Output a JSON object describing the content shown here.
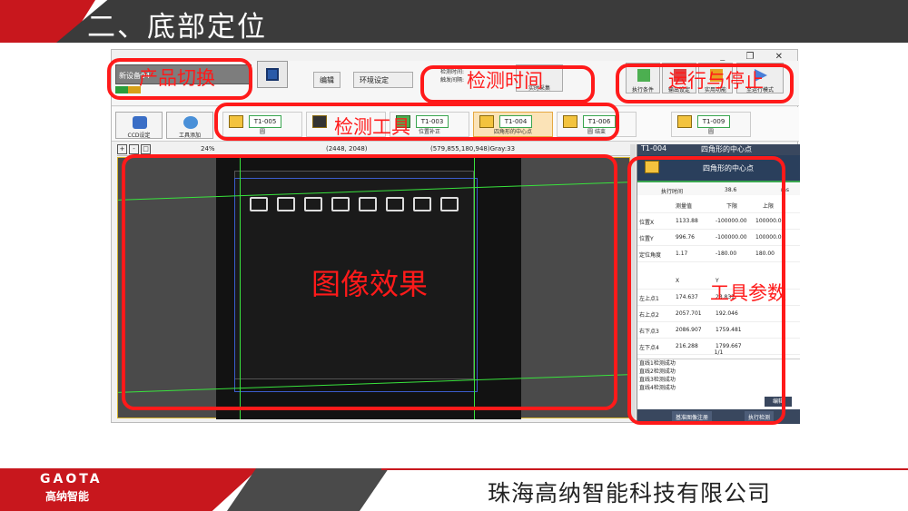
{
  "slide": {
    "title": "二、底部定位",
    "company": "珠海高纳智能科技有限公司",
    "logo_en": "GAOTA",
    "logo_cn": "高纳智能"
  },
  "app": {
    "window_controls": "_ ❐ ✕",
    "product_name": "新设备04",
    "menu": [
      "编辑",
      "环境设定"
    ],
    "detect_labels": [
      "检测时间:",
      "触发间隔:"
    ],
    "detect_button": "实时采集",
    "run_buttons": [
      "执行条件",
      "输出设定",
      "实用功能",
      "至运行模式"
    ],
    "ccd_button": "CCD设定",
    "add_tool_button": "工具添加",
    "tools": [
      {
        "id": "T1-005",
        "name": "圆"
      },
      {
        "id": "",
        "name": ""
      },
      {
        "id": "T1-003",
        "name": "位置补正"
      },
      {
        "id": "T1-004",
        "name": "四角形的中心点"
      },
      {
        "id": "T1-006",
        "name": "圆 结束"
      },
      {
        "id": "T1-009",
        "name": "圆"
      }
    ],
    "zoom": "24%",
    "image_size": "(2448, 2048)",
    "coords": "(579,855,180,948)Gray:33",
    "panel": {
      "header": "T1-004",
      "header_title": "四角形的中心点",
      "title": "四角形的中心点",
      "time_label": "执行时间",
      "time_value": "38.6",
      "time_unit": "ms",
      "cols": [
        "测量值",
        "下限",
        "上限"
      ],
      "rows": [
        [
          "位置X",
          "1133.88",
          "-100000.00",
          "100000.00"
        ],
        [
          "位置Y",
          "996.76",
          "-100000.00",
          "100000.00"
        ],
        [
          "定位角度",
          "1.17",
          "-180.00",
          "180.00"
        ]
      ],
      "xy_cols": [
        "X",
        "Y"
      ],
      "points": [
        [
          "左上点1",
          "174.637",
          "23.831"
        ],
        [
          "右上点2",
          "2057.701",
          "192.046"
        ],
        [
          "右下点3",
          "2086.907",
          "1759.481"
        ],
        [
          "左下点4",
          "216.288",
          "1799.667"
        ]
      ],
      "page": "1/1",
      "status": [
        "直线1检测成功",
        "直线2检测成功",
        "直线3检测成功",
        "直线4检测成功"
      ],
      "edit": "编辑",
      "foot_buttons": [
        "基准图像注册",
        "执行检测"
      ]
    }
  },
  "annotations": {
    "product": "产品切换",
    "detect_time": "检测时间",
    "run_stop": "运行与停止",
    "tools": "检测工具",
    "image": "图像效果",
    "params": "工具参数"
  },
  "colors": {
    "accent_red": "#c8171d",
    "annotation": "#ff1a1a",
    "overlay_green": "#39e33d"
  }
}
